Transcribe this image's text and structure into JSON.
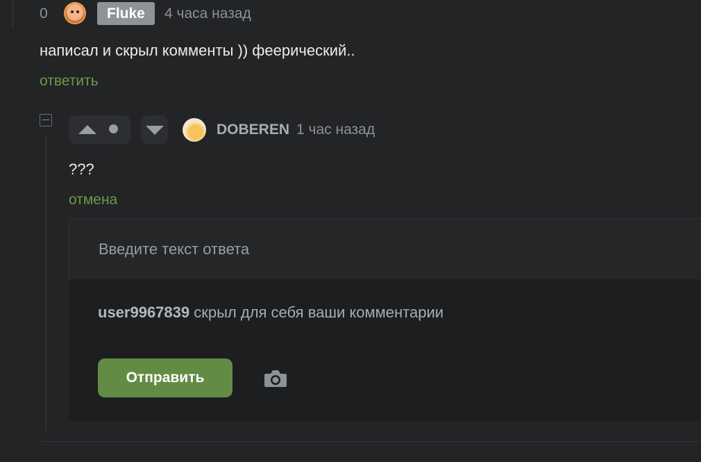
{
  "comment": {
    "rating": "0",
    "author": "Fluke",
    "time": "4 часа назад",
    "text": "написал и скрыл комменты )) феерический..",
    "reply_label": "ответить"
  },
  "reply": {
    "author": "DOBEREN",
    "time": "1 час назад",
    "text": "???",
    "cancel_label": "отмена"
  },
  "reply_form": {
    "placeholder": "Введите текст ответа",
    "notice_user": "user9967839",
    "notice_text": " скрыл для себя ваши комментарии",
    "send_label": "Отправить"
  },
  "icons": {
    "collapse": "minus-square-icon",
    "upvote": "arrow-up-icon",
    "downvote": "arrow-down-icon",
    "camera": "camera-icon"
  },
  "colors": {
    "background": "#222426",
    "link_green": "#6a9a48",
    "button_green": "#628c45",
    "author_badge": "#8f9399"
  }
}
